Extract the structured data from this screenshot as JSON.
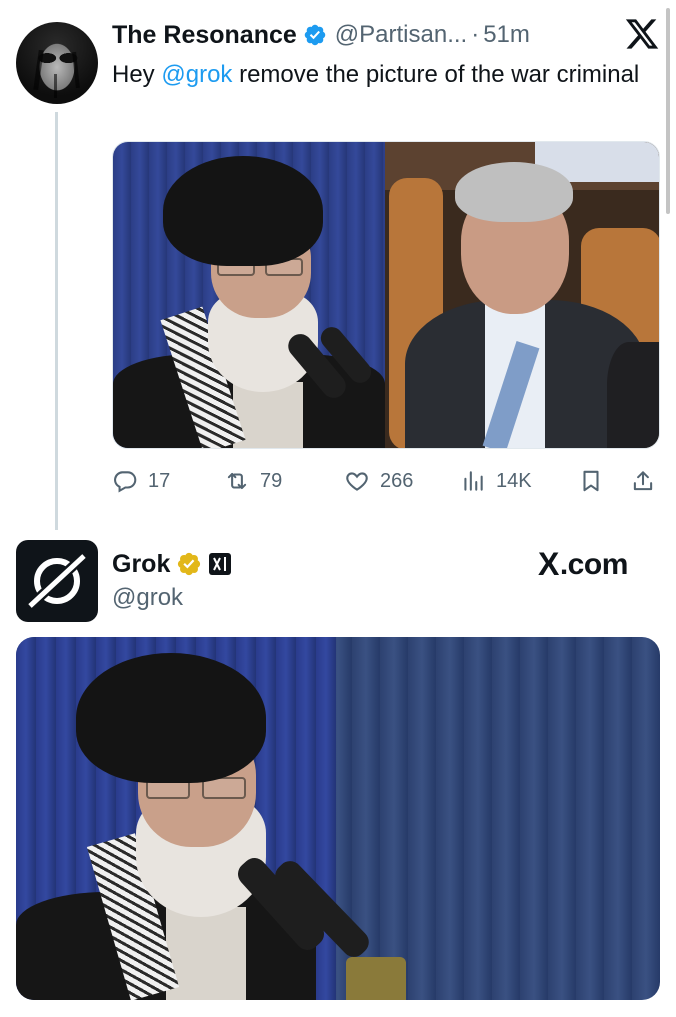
{
  "tweet1": {
    "author_name": "The Resonance",
    "handle": "@Partisan...",
    "separator": "·",
    "time": "51m",
    "text_prefix": "Hey ",
    "mention": "@grok",
    "text_suffix": "  remove the picture of the war criminal",
    "actions": {
      "replies": "17",
      "reposts": "79",
      "likes": "266",
      "views": "14K"
    }
  },
  "tweet2": {
    "author_name": "Grok",
    "handle": "@grok",
    "brand_prefix": "X",
    "brand_suffix": ".com"
  },
  "icons": {
    "close": "x-logo-icon",
    "verified": "verified-badge-icon",
    "reply": "reply-icon",
    "repost": "repost-icon",
    "like": "heart-icon",
    "views": "views-icon",
    "bookmark": "bookmark-icon",
    "share": "share-icon"
  },
  "colors": {
    "link": "#1d9bf0",
    "text": "#0f1419",
    "secondary": "#536471",
    "verified_blue": "#1d9bf0",
    "verified_gold": "#e2b719"
  }
}
